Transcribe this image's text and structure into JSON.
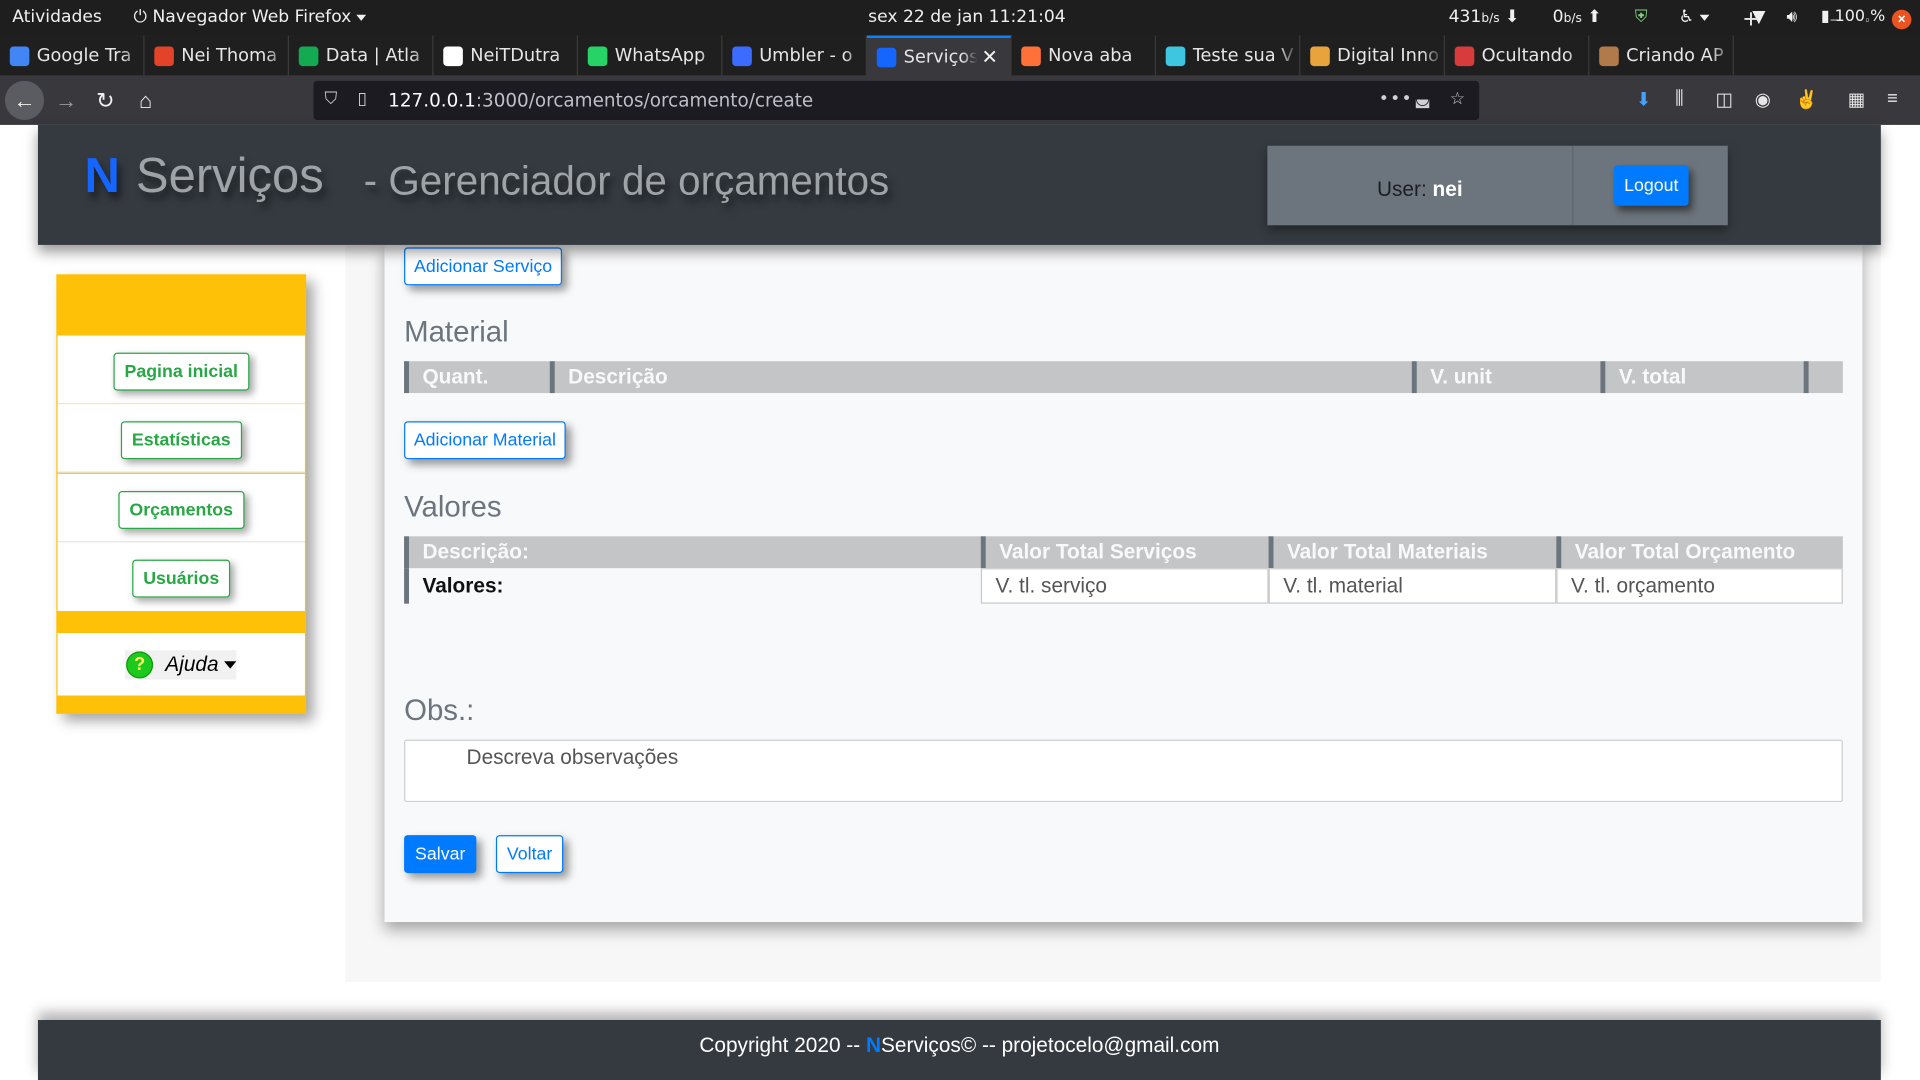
{
  "system_bar": {
    "activities": "Atividades",
    "app_menu": "Navegador Web Firefox",
    "clock": "sex 22 de jan  11:21:04",
    "net_down": "431",
    "net_down_unit": "b/s",
    "net_up": "0",
    "net_up_unit": "b/s",
    "battery": "100 %"
  },
  "browser": {
    "tabs": [
      {
        "label": "Google Tra",
        "icon": "google-translate-icon",
        "color": "#4285f4"
      },
      {
        "label": "Nei Thoma",
        "icon": "gitlab-icon",
        "color": "#e24329"
      },
      {
        "label": "Data | Atla",
        "icon": "mongodb-leaf-icon",
        "color": "#13aa52"
      },
      {
        "label": "NeiTDutra",
        "icon": "github-icon",
        "color": "#ffffff"
      },
      {
        "label": "WhatsApp",
        "icon": "whatsapp-icon",
        "color": "#25d366"
      },
      {
        "label": "Umbler - o",
        "icon": "umbler-icon",
        "color": "#3b6cff"
      },
      {
        "label": "Serviços",
        "icon": "n-logo-icon",
        "color": "#1565ff"
      },
      {
        "label": "Nova aba",
        "icon": "firefox-icon",
        "color": "#ff7139"
      },
      {
        "label": "Teste sua V",
        "icon": "speedtest-icon",
        "color": "#3ec6e0"
      },
      {
        "label": "Digital Inno",
        "icon": "digital-innovation-icon",
        "color": "#e8a33d"
      },
      {
        "label": "Ocultando",
        "icon": "qa-icon",
        "color": "#d83b3b"
      },
      {
        "label": "Criando AP",
        "icon": "article-icon",
        "color": "#b07a4a"
      }
    ],
    "active_tab_index": 6,
    "url_host": "127.0.0.1",
    "url_rest": ":3000/orcamentos/orcamento/create"
  },
  "header": {
    "logo_letter": "N",
    "logo_text": "Serviços",
    "subtitle": "- Gerenciador de orçamentos",
    "user_label": "User:",
    "user_name": "nei",
    "logout_label": "Logout"
  },
  "sidebar": {
    "items": [
      {
        "label": "Pagina inicial"
      },
      {
        "label": "Estatísticas"
      },
      {
        "label": "Orçamentos"
      },
      {
        "label": "Usuários"
      }
    ],
    "help_label": "Ajuda",
    "help_icon": "?"
  },
  "form": {
    "add_service_label": "Adicionar Serviço",
    "material_title": "Material",
    "material_columns": [
      "Quant.",
      "Descrição",
      "V. unit",
      "V. total",
      ""
    ],
    "add_material_label": "Adicionar Material",
    "valores_title": "Valores",
    "valores_columns": [
      "Descrição:",
      "Valor Total Serviços",
      "Valor Total Materiais",
      "Valor Total Orçamento"
    ],
    "valores_row_label": "Valores:",
    "valores_placeholders": [
      "V. tl. serviço",
      "V. tl. material",
      "V. tl. orçamento"
    ],
    "obs_title": "Obs.:",
    "obs_placeholder": "Descreva observações",
    "save_label": "Salvar",
    "back_label": "Voltar"
  },
  "footer": {
    "prefix": "Copyright 2020 -- ",
    "brand_n": "N",
    "suffix": "Serviços© -- projetocelo@gmail.com"
  },
  "colors": {
    "primary": "#007bff",
    "success": "#28a745",
    "warning": "#ffc107",
    "dark": "#343a40",
    "secondary": "#6c757d"
  }
}
